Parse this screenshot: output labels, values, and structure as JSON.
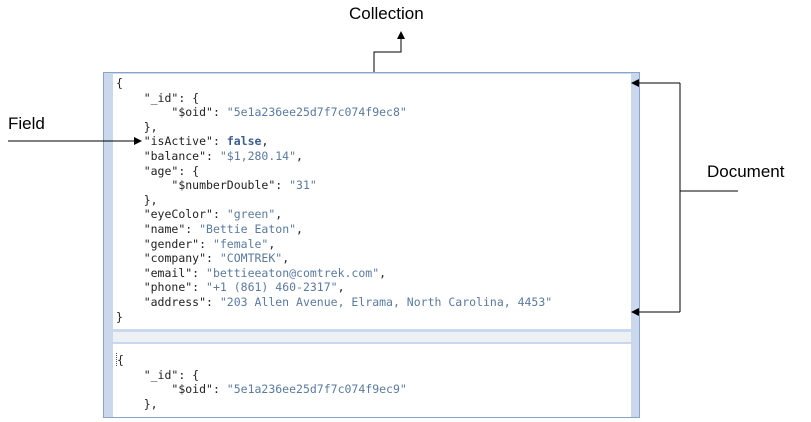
{
  "labels": {
    "collection": "Collection",
    "field": "Field",
    "document": "Document"
  },
  "document1": {
    "open": "{",
    "id_key": "\"_id\"",
    "id_open": ": {",
    "oid_key": "\"$oid\"",
    "oid_value": "\"5e1a236ee25d7f7c074f9ec8\"",
    "id_close": "},",
    "isActive_key": "\"isActive\"",
    "isActive_value": "false",
    "balance_key": "\"balance\"",
    "balance_value": "\"$1,280.14\"",
    "age_key": "\"age\"",
    "age_open": ": {",
    "numberDouble_key": "\"$numberDouble\"",
    "numberDouble_value": "\"31\"",
    "age_close": "},",
    "eyeColor_key": "\"eyeColor\"",
    "eyeColor_value": "\"green\"",
    "name_key": "\"name\"",
    "name_value": "\"Bettie Eaton\"",
    "gender_key": "\"gender\"",
    "gender_value": "\"female\"",
    "company_key": "\"company\"",
    "company_value": "\"COMTREK\"",
    "email_key": "\"email\"",
    "email_value": "\"bettieeaton@comtrek.com\"",
    "phone_key": "\"phone\"",
    "phone_value": "\"+1 (861) 460-2317\"",
    "address_key": "\"address\"",
    "address_value": "\"203 Allen Avenue, Elrama, North Carolina, 4453\"",
    "close": "}"
  },
  "document2": {
    "open": "{",
    "id_key": "\"_id\"",
    "id_open": ": {",
    "oid_key": "\"$oid\"",
    "oid_value": "\"5e1a236ee25d7f7c074f9ec9\"",
    "id_close": "},"
  }
}
